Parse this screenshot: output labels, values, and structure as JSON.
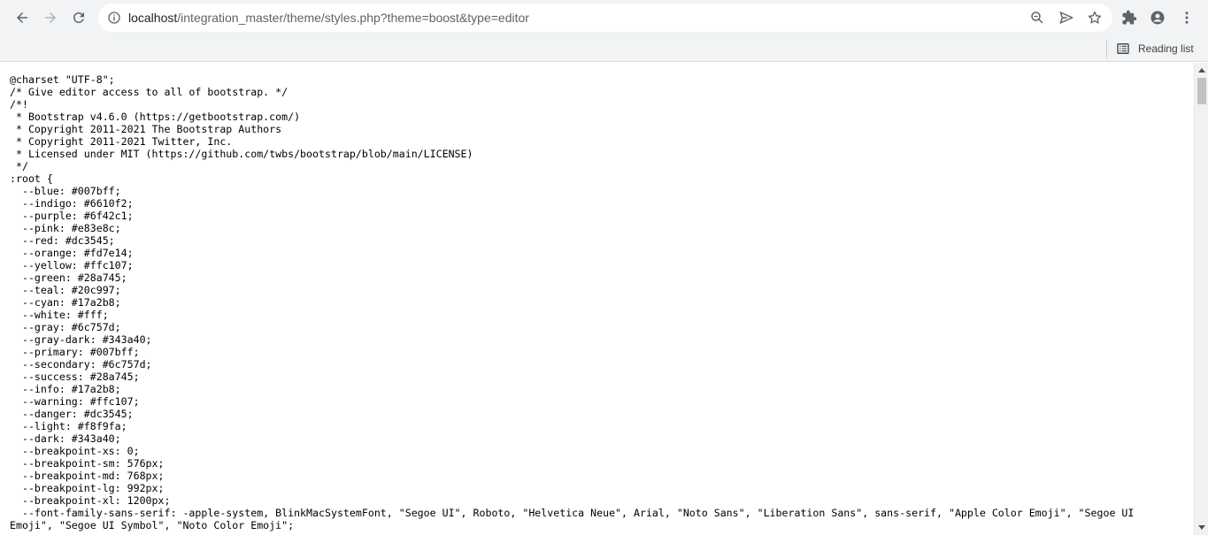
{
  "browser": {
    "url_host": "localhost",
    "url_path": "/integration_master/theme/styles.php?theme=boost&type=editor",
    "reading_list_label": "Reading list",
    "icons": {
      "back": "back-arrow-icon",
      "forward": "forward-arrow-icon",
      "reload": "reload-icon",
      "site_info": "info-icon",
      "zoom": "zoom-icon",
      "send": "send-icon",
      "bookmark": "star-icon",
      "extensions": "puzzle-icon",
      "profile": "avatar-icon",
      "menu": "kebab-menu-icon",
      "reading_list": "reading-list-icon"
    }
  },
  "source_lines": [
    "@charset \"UTF-8\";",
    "/* Give editor access to all of bootstrap. */",
    "/*!",
    " * Bootstrap v4.6.0 (https://getbootstrap.com/)",
    " * Copyright 2011-2021 The Bootstrap Authors",
    " * Copyright 2011-2021 Twitter, Inc.",
    " * Licensed under MIT (https://github.com/twbs/bootstrap/blob/main/LICENSE)",
    " */",
    ":root {",
    "  --blue: #007bff;",
    "  --indigo: #6610f2;",
    "  --purple: #6f42c1;",
    "  --pink: #e83e8c;",
    "  --red: #dc3545;",
    "  --orange: #fd7e14;",
    "  --yellow: #ffc107;",
    "  --green: #28a745;",
    "  --teal: #20c997;",
    "  --cyan: #17a2b8;",
    "  --white: #fff;",
    "  --gray: #6c757d;",
    "  --gray-dark: #343a40;",
    "  --primary: #007bff;",
    "  --secondary: #6c757d;",
    "  --success: #28a745;",
    "  --info: #17a2b8;",
    "  --warning: #ffc107;",
    "  --danger: #dc3545;",
    "  --light: #f8f9fa;",
    "  --dark: #343a40;",
    "  --breakpoint-xs: 0;",
    "  --breakpoint-sm: 576px;",
    "  --breakpoint-md: 768px;",
    "  --breakpoint-lg: 992px;",
    "  --breakpoint-xl: 1200px;",
    "  --font-family-sans-serif: -apple-system, BlinkMacSystemFont, \"Segoe UI\", Roboto, \"Helvetica Neue\", Arial, \"Noto Sans\", \"Liberation Sans\", sans-serif, \"Apple Color Emoji\", \"Segoe UI",
    "Emoji\", \"Segoe UI Symbol\", \"Noto Color Emoji\";"
  ]
}
